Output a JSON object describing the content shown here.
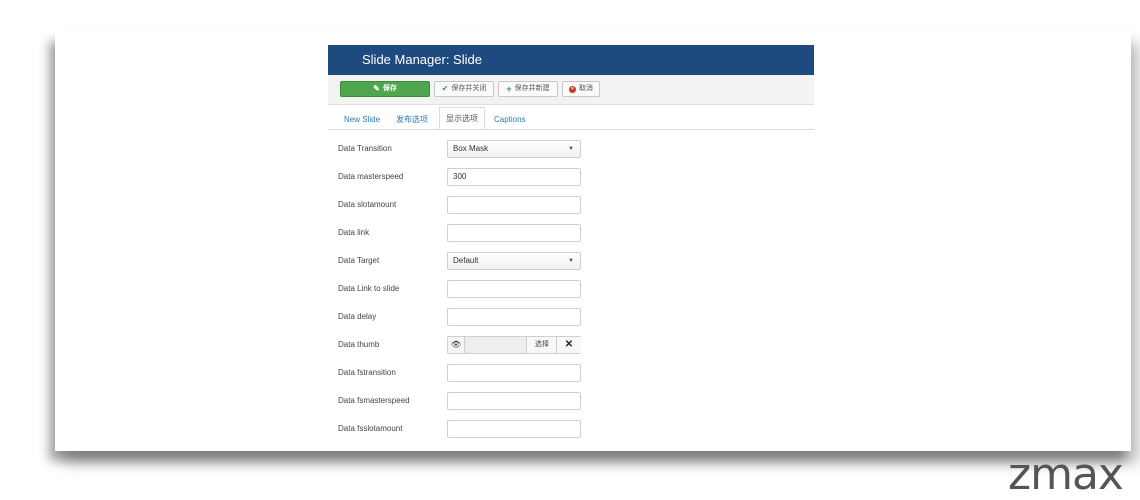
{
  "window": {
    "title": "Slide Manager: Slide"
  },
  "toolbar": {
    "save_label": "保存",
    "save_close_label": "保存并关闭",
    "save_new_label": "保存并新建",
    "cancel_label": "取消"
  },
  "tabs": [
    {
      "label": "New Slide",
      "active": false
    },
    {
      "label": "发布选项",
      "active": false
    },
    {
      "label": "显示选项",
      "active": true
    },
    {
      "label": "Captions",
      "active": false
    }
  ],
  "form": {
    "transition": {
      "label": "Data Transition",
      "value": "Box Mask"
    },
    "masterspeed": {
      "label": "Data masterspeed",
      "value": "300"
    },
    "slotamount": {
      "label": "Data slotamount",
      "value": ""
    },
    "link": {
      "label": "Data link",
      "value": ""
    },
    "target": {
      "label": "Data Target",
      "value": "Default"
    },
    "link_to_slide": {
      "label": "Data Link to slide",
      "value": ""
    },
    "delay": {
      "label": "Data delay",
      "value": ""
    },
    "thumb": {
      "label": "Data thumb",
      "select_label": "选择",
      "clear_label": "✕"
    },
    "fstransition": {
      "label": "Data fstransition",
      "value": ""
    },
    "fsmasterspeed": {
      "label": "Data fsmasterspeed",
      "value": ""
    },
    "fsslotamount": {
      "label": "Data fsslotamount",
      "value": ""
    }
  },
  "brand": {
    "text": "zmax"
  }
}
